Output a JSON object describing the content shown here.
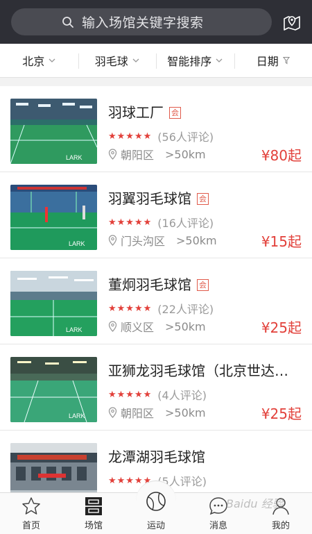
{
  "search": {
    "placeholder": "输入场馆关键字搜索",
    "icon": "search-icon"
  },
  "header": {
    "map_icon": "map-pin-icon"
  },
  "filters": [
    {
      "label": "北京",
      "icon": "chevron-down-icon"
    },
    {
      "label": "羽毛球",
      "icon": "chevron-down-icon"
    },
    {
      "label": "智能排序",
      "icon": "chevron-down-icon"
    },
    {
      "label": "日期",
      "icon": "filter-icon"
    }
  ],
  "venues": [
    {
      "name": "羽球工厂",
      "badge": "会",
      "reviews": "(56人评论)",
      "district": "朝阳区",
      "distance": ">50km",
      "price": "¥80起",
      "stars": 5
    },
    {
      "name": "羽翼羽毛球馆",
      "badge": "会",
      "reviews": "(16人评论)",
      "district": "门头沟区",
      "distance": ">50km",
      "price": "¥15起",
      "stars": 5
    },
    {
      "name": "董炯羽毛球馆",
      "badge": "会",
      "reviews": "(22人评论)",
      "district": "顺义区",
      "distance": ">50km",
      "price": "¥25起",
      "stars": 5
    },
    {
      "name": "亚狮龙羽毛球馆（北京世达…",
      "badge": "",
      "reviews": "(4人评论)",
      "district": "朝阳区",
      "distance": ">50km",
      "price": "¥25起",
      "stars": 5
    },
    {
      "name": "龙潭湖羽毛球馆",
      "badge": "",
      "reviews": "(5人评论)",
      "district": "",
      "distance": "",
      "price": "",
      "stars": 5
    }
  ],
  "tabs": [
    {
      "label": "首页",
      "icon": "star-icon"
    },
    {
      "label": "场馆",
      "icon": "venue-icon"
    },
    {
      "label": "运动",
      "icon": "ball-icon"
    },
    {
      "label": "消息",
      "icon": "message-icon"
    },
    {
      "label": "我的",
      "icon": "user-icon"
    }
  ],
  "colors": {
    "accent": "#e2403a",
    "header_bg": "#2e2f36",
    "search_bg": "#4a4b52"
  },
  "watermark": "Baidu 经验"
}
